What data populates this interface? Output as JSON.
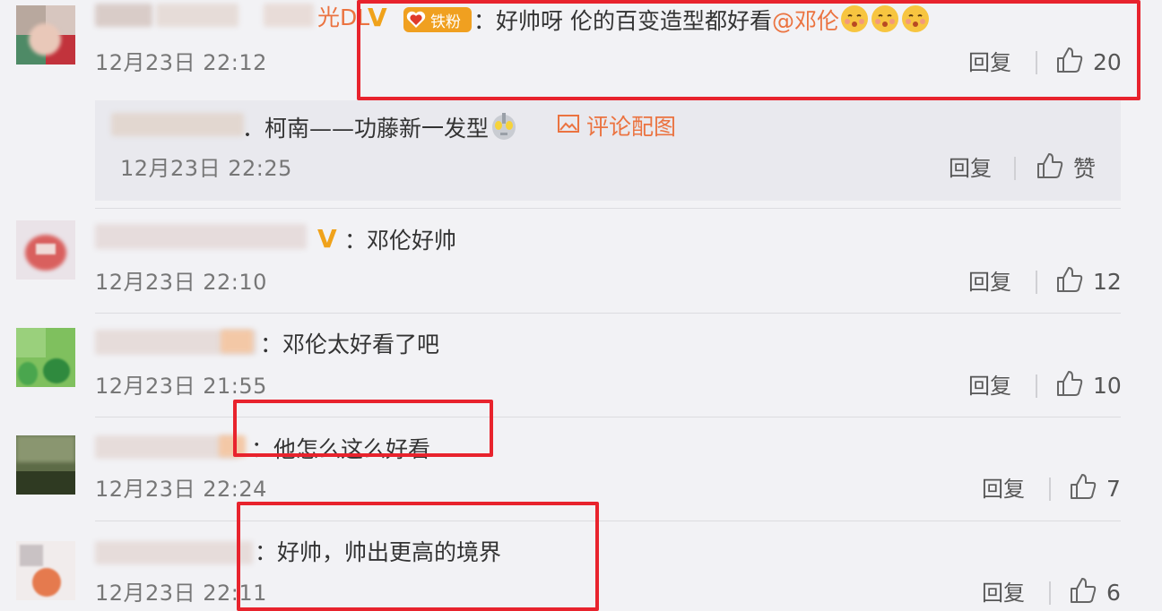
{
  "comments": [
    {
      "body": "：好帅呀 伦的百变造型都好看",
      "mention": "@邓伦",
      "fan_badge": "铁粉",
      "time": "12月23日 22:12",
      "reply": "回复",
      "likes": "20"
    },
    {
      "body": "柯南——功藤新一发型",
      "attachment": "评论配图",
      "time": "12月23日 22:25",
      "reply": "回复",
      "likes": "赞"
    },
    {
      "body": "：邓伦好帅",
      "time": "12月23日 22:10",
      "reply": "回复",
      "likes": "12"
    },
    {
      "body": "：邓伦太好看了吧",
      "time": "12月23日 21:55",
      "reply": "回复",
      "likes": "10"
    },
    {
      "body": "：他怎么这么好看",
      "time": "12月23日 22:24",
      "reply": "回复",
      "likes": "7"
    },
    {
      "body": "：好帅，帅出更高的境界",
      "time": "12月23日 22:11",
      "reply": "回复",
      "likes": "6"
    }
  ],
  "partial_username_1": "光DL",
  "colors": {
    "highlight_box": "#e8232d",
    "mention": "#eb7340",
    "verified": "#f0a21a"
  }
}
